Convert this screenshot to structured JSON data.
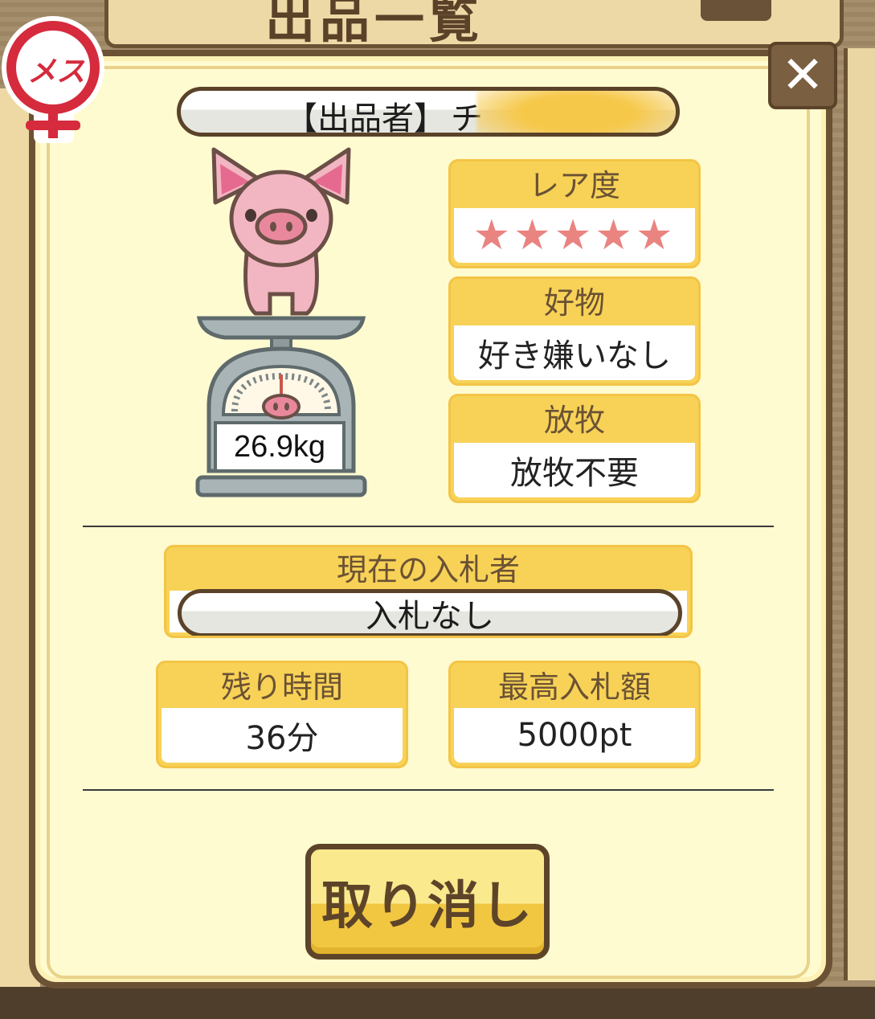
{
  "background": {
    "title": "出品一覧"
  },
  "badge": {
    "gender_label": "メス"
  },
  "seller": {
    "label": "【出品者】",
    "name": "チ"
  },
  "pig": {
    "weight": "26.9kg"
  },
  "cards": {
    "rarity": {
      "title": "レア度",
      "stars": "★★★★★",
      "value": 5
    },
    "favorite": {
      "title": "好物",
      "value": "好き嫌いなし"
    },
    "grazing": {
      "title": "放牧",
      "value": "放牧不要"
    }
  },
  "bid": {
    "current_bidder_title": "現在の入札者",
    "current_bidder_value": "入札なし",
    "remaining_time_title": "残り時間",
    "remaining_time_value": "36分",
    "highest_bid_title": "最高入札額",
    "highest_bid_value": "5000pt"
  },
  "actions": {
    "cancel_label": "取り消し"
  },
  "colors": {
    "card_header": "#f7d257",
    "dialog_bg": "#fffbd0",
    "border_brown": "#6b5234",
    "star": "#e98480",
    "female_red": "#d52b3d"
  }
}
